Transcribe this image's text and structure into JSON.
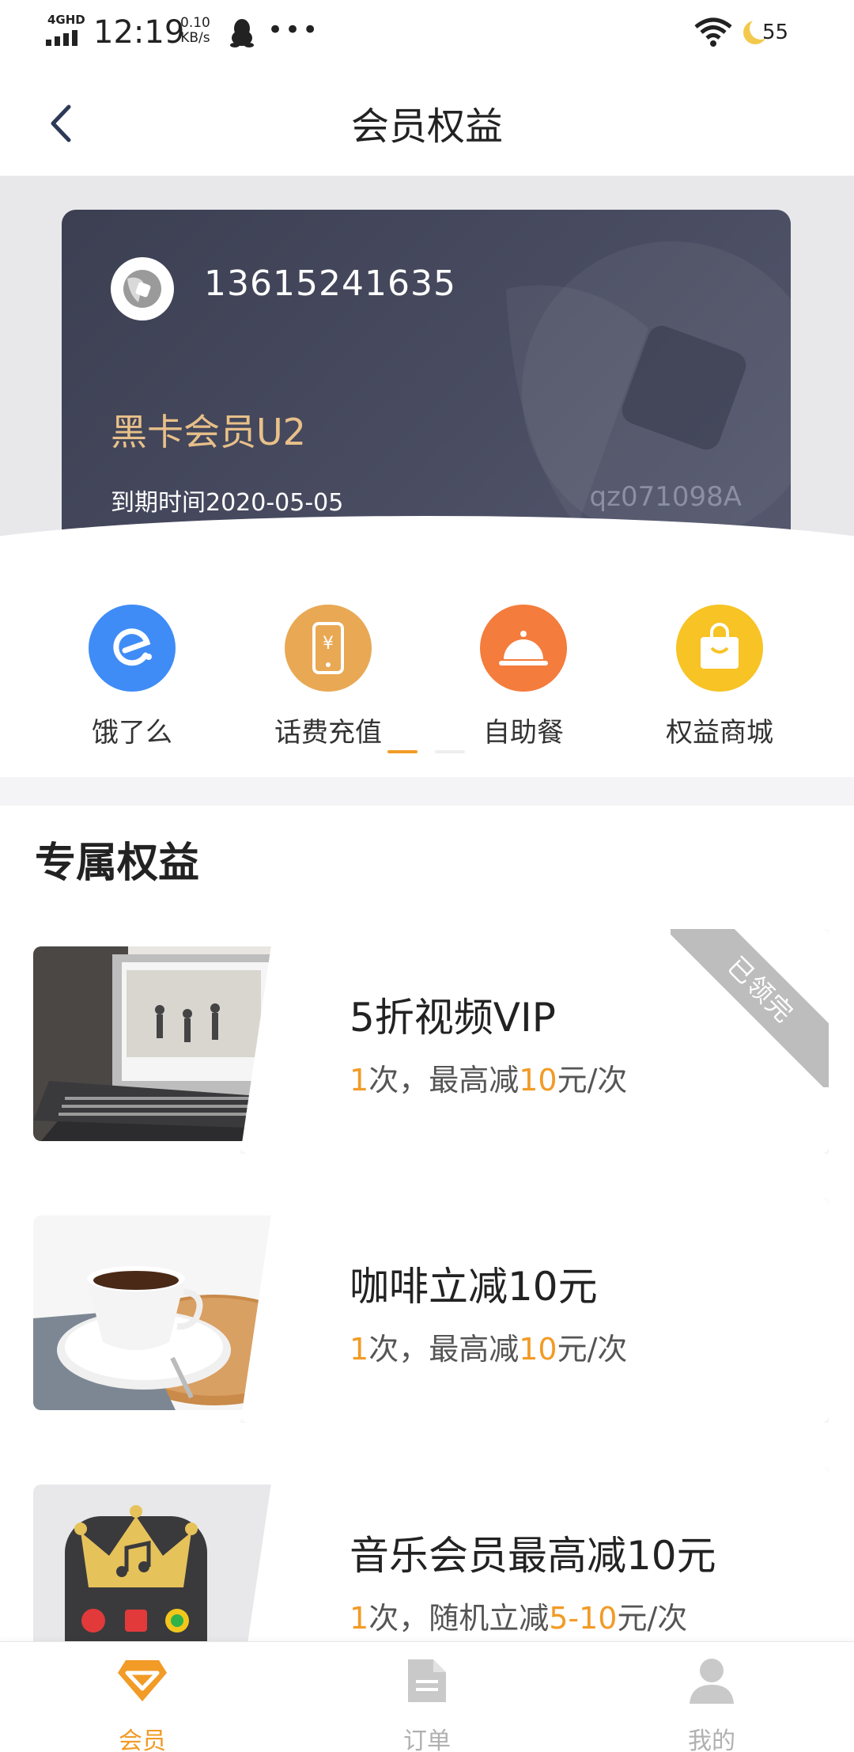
{
  "status_bar": {
    "network": "4GHD",
    "time": "12:19",
    "speed_value": "0.10",
    "speed_unit": "KB/s",
    "more": "•••",
    "battery": "55"
  },
  "header": {
    "title": "会员权益",
    "back_icon": "chevron-left-icon"
  },
  "member_card": {
    "phone": "13615241635",
    "level": "黑卡会员U2",
    "expire": "到期时间2020-05-05",
    "code": "qz071098A",
    "colors": {
      "card": "#43465a",
      "level": "#e8c089"
    }
  },
  "quick_menu": {
    "items": [
      {
        "label": "饿了么",
        "icon": "eleme-icon",
        "color": "#3f8cf7"
      },
      {
        "label": "话费充值",
        "icon": "phone-recharge-icon",
        "color": "#e9a854"
      },
      {
        "label": "自助餐",
        "icon": "dining-cloche-icon",
        "color": "#f47c3c"
      },
      {
        "label": "权益商城",
        "icon": "shopping-bag-icon",
        "color": "#f7c325"
      }
    ],
    "page_count": 2,
    "current_page": 1
  },
  "benefits": {
    "title": "专属权益",
    "items": [
      {
        "title": "5折视频VIP",
        "count": "1",
        "sub_a": "次，最高减",
        "amount": "10",
        "sub_b": "元/次",
        "ribbon": "已领完",
        "thumb": "laptop-video-image"
      },
      {
        "title": "咖啡立减10元",
        "count": "1",
        "sub_a": "次，最高减",
        "amount": "10",
        "sub_b": "元/次",
        "thumb": "coffee-cup-image"
      },
      {
        "title": "音乐会员最高减10元",
        "count": "1",
        "sub_a": "次，随机立减",
        "amount_a": "5",
        "dash": "-",
        "amount_b": "10",
        "sub_b": "元/次",
        "thumb": "music-crown-image"
      }
    ]
  },
  "tab_bar": {
    "tabs": [
      {
        "label": "会员",
        "icon": "diamond-icon",
        "active": true
      },
      {
        "label": "订单",
        "icon": "document-icon",
        "active": false
      },
      {
        "label": "我的",
        "icon": "user-icon",
        "active": false
      }
    ],
    "active_color": "#f29b26"
  }
}
